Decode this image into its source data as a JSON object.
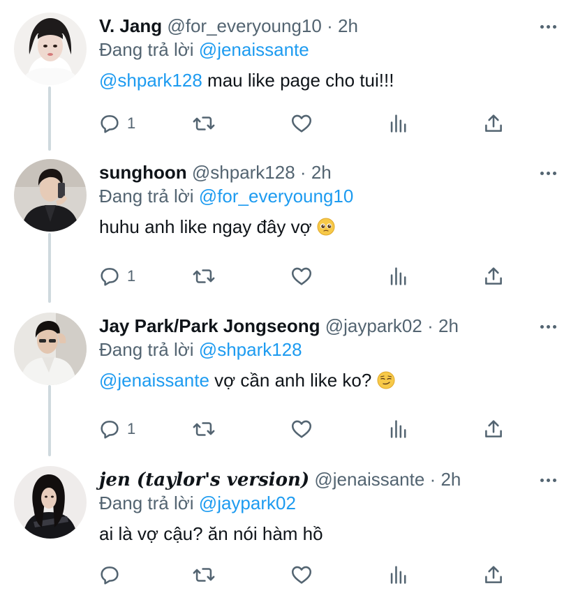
{
  "tweets": [
    {
      "name": "V. Jang",
      "handle": "@for_everyoung10",
      "dot": "·",
      "time": "2h",
      "reply_prefix": "Đang trả lời",
      "reply_to": "@jenaissante",
      "text_mention": "@shpark128",
      "text": " mau like page cho tui!!!",
      "reply_count": "1"
    },
    {
      "name": "sunghoon",
      "handle": "@shpark128",
      "dot": "·",
      "time": "2h",
      "reply_prefix": "Đang trả lời",
      "reply_to": "@for_everyoung10",
      "text_mention": "",
      "text": "huhu anh like ngay đây vợ ",
      "emoji": "pleading-face-emoji",
      "reply_count": "1"
    },
    {
      "name": "Jay Park/Park Jongseong",
      "handle": "@jaypark02",
      "dot": "·",
      "time": "2h",
      "reply_prefix": "Đang trả lời",
      "reply_to": "@shpark128",
      "text_mention": "@jenaissante",
      "text": " vợ cần anh like ko? ",
      "emoji": "smirking-face-emoji",
      "reply_count": "1"
    },
    {
      "name": "jen (taylor's version)",
      "handle": "@jenaissante",
      "dot": "·",
      "time": "2h",
      "reply_prefix": "Đang trả lời",
      "reply_to": "@jaypark02",
      "text_mention": "",
      "text": "ai là vợ cậu? ăn nói hàm hồ",
      "reply_count": ""
    }
  ],
  "icons": {
    "reply": "reply-icon",
    "retweet": "retweet-icon",
    "like": "heart-icon",
    "views": "analytics-icon",
    "share": "share-icon",
    "more": "more-icon"
  },
  "colors": {
    "mention": "#1d9bf0",
    "secondary": "#536471",
    "thread_line": "#cfd9de"
  }
}
